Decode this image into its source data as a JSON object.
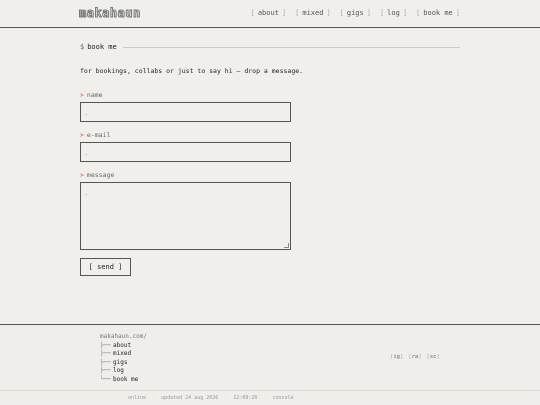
{
  "header": {
    "logo": "makahaun",
    "nav": [
      {
        "label": "about"
      },
      {
        "label": "mixed"
      },
      {
        "label": "gigs"
      },
      {
        "label": "log"
      },
      {
        "label": "book me"
      }
    ],
    "bracket_open": "[",
    "bracket_close": "]"
  },
  "section": {
    "prompt": "$",
    "title": "book me"
  },
  "intro": "for bookings, collabs or just to say hi — drop a message.",
  "form": {
    "caret": ">",
    "name": {
      "label": "name",
      "placeholder": "_"
    },
    "email": {
      "label": "e-mail",
      "placeholder": "_"
    },
    "message": {
      "label": "message",
      "placeholder": "_"
    },
    "send_label": "[ send ]"
  },
  "footer": {
    "tree_root": "makahaun.com/",
    "tree": [
      {
        "branch": "├──",
        "label": "about"
      },
      {
        "branch": "├──",
        "label": "mixed"
      },
      {
        "branch": "├──",
        "label": "gigs"
      },
      {
        "branch": "├──",
        "label": "log"
      },
      {
        "branch": "└──",
        "label": "book me"
      }
    ],
    "socials": [
      {
        "label": "ig"
      },
      {
        "label": "ra"
      },
      {
        "label": "sc"
      }
    ],
    "status": {
      "online": "online",
      "updated": "updated 24 aug 2026",
      "time": "12:09:26",
      "mode": "console",
      "sep": "·"
    }
  },
  "colors": {
    "background": "#f0efeb",
    "accent": "#d4553a",
    "text": "#222222",
    "border": "#555555"
  }
}
